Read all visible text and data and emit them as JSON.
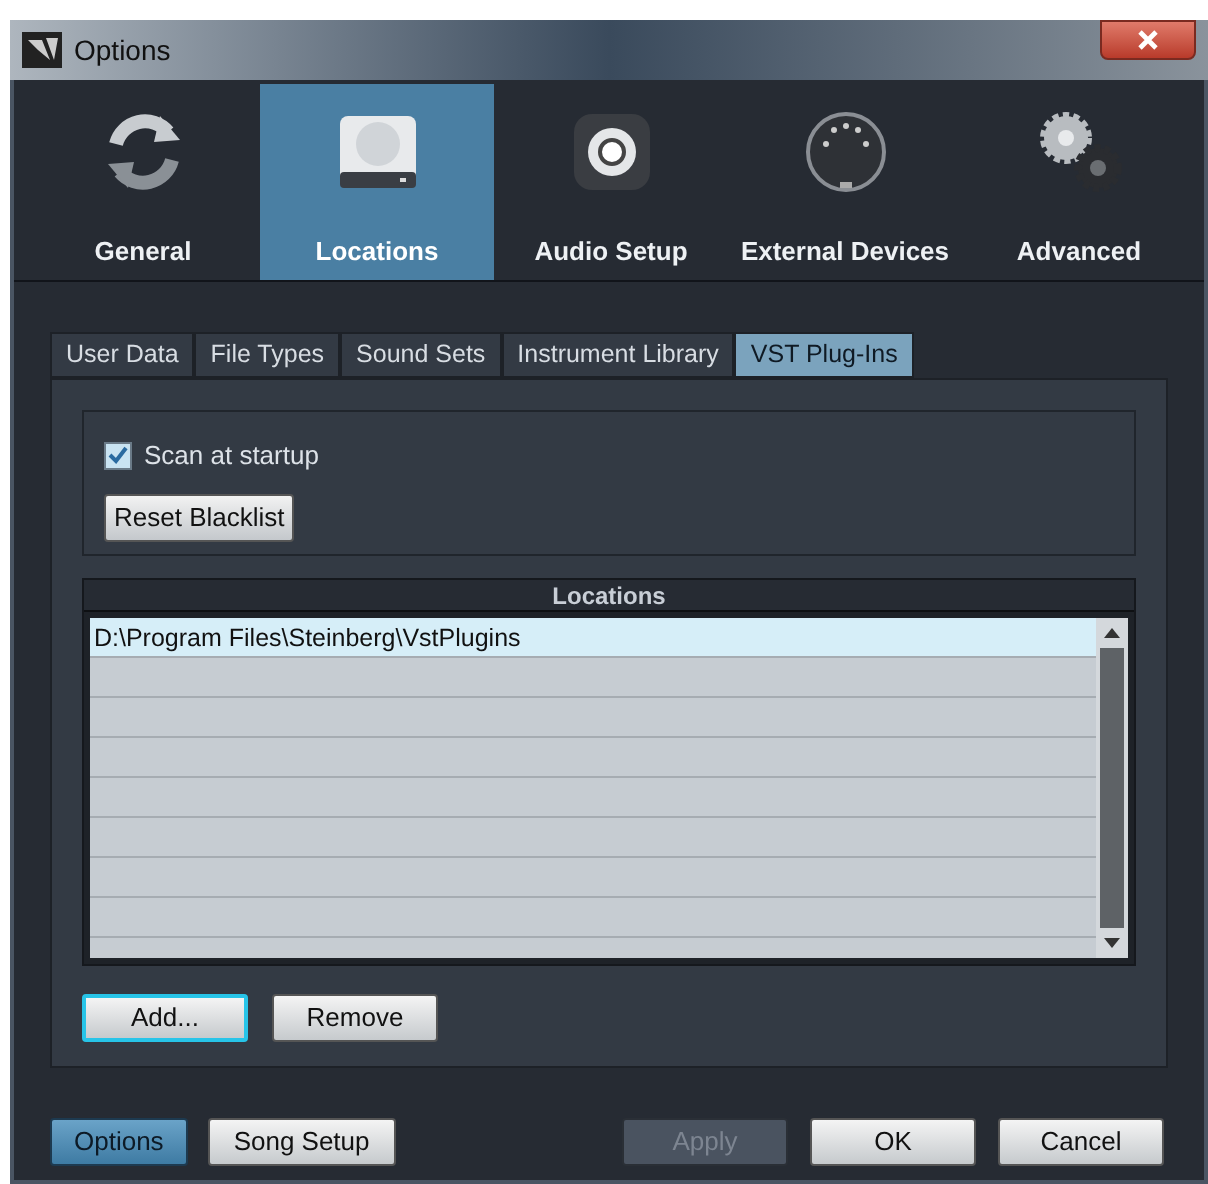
{
  "window": {
    "title": "Options"
  },
  "categories": [
    {
      "label": "General",
      "selected": false
    },
    {
      "label": "Locations",
      "selected": true
    },
    {
      "label": "Audio Setup",
      "selected": false
    },
    {
      "label": "External Devices",
      "selected": false
    },
    {
      "label": "Advanced",
      "selected": false
    }
  ],
  "tabs": [
    {
      "label": "User Data",
      "selected": false
    },
    {
      "label": "File Types",
      "selected": false
    },
    {
      "label": "Sound Sets",
      "selected": false
    },
    {
      "label": "Instrument Library",
      "selected": false
    },
    {
      "label": "VST Plug-Ins",
      "selected": true
    }
  ],
  "scan_at_startup": {
    "label": "Scan at startup",
    "checked": true
  },
  "reset_button": "Reset Blacklist",
  "locations": {
    "title": "Locations",
    "rows": [
      {
        "path": "D:\\Program Files\\Steinberg\\VstPlugins",
        "selected": true
      }
    ]
  },
  "list_buttons": [
    {
      "label": "Add...",
      "focused": true
    },
    {
      "label": "Remove",
      "focused": false
    }
  ],
  "left_buttons": [
    {
      "label": "Options",
      "selected": true
    },
    {
      "label": "Song Setup",
      "selected": false
    }
  ],
  "right_buttons": [
    {
      "label": "Apply",
      "disabled": true
    },
    {
      "label": "OK",
      "disabled": false
    },
    {
      "label": "Cancel",
      "disabled": false
    }
  ]
}
